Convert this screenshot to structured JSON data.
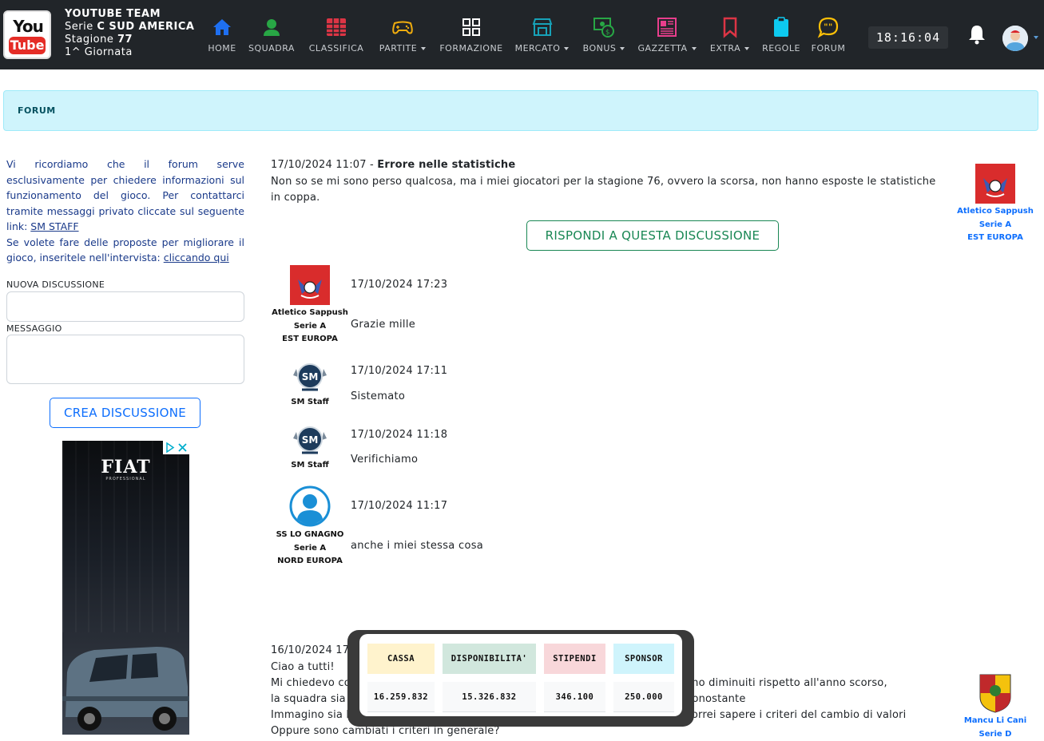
{
  "team": {
    "name": "YOUTUBE TEAM",
    "series_prefix": "Serie",
    "series": "C SUD AMERICA",
    "season_prefix": "Stagione",
    "season": "77",
    "round": "1^ Giornata",
    "logo_top": "You",
    "logo_bottom": "Tube"
  },
  "nav": [
    {
      "label": "HOME",
      "icon": "home-icon",
      "color": "#1e6ff0"
    },
    {
      "label": "SQUADRA",
      "icon": "user-icon",
      "color": "#28a745"
    },
    {
      "label": "CLASSIFICA",
      "icon": "table-icon",
      "color": "#dc3545"
    },
    {
      "label": "PARTITE",
      "icon": "gamepad-icon",
      "color": "#f0ad0e",
      "dropdown": true
    },
    {
      "label": "FORMAZIONE",
      "icon": "grid-icon",
      "color": "#ffffff"
    },
    {
      "label": "MERCATO",
      "icon": "shop-icon",
      "color": "#17a2b8",
      "dropdown": true
    },
    {
      "label": "BONUS",
      "icon": "cash-icon",
      "color": "#28a745",
      "dropdown": true
    },
    {
      "label": "GAZZETTA",
      "icon": "newspaper-icon",
      "color": "#e83e8c",
      "dropdown": true
    },
    {
      "label": "EXTRA",
      "icon": "bookmark-icon",
      "color": "#dc3545",
      "dropdown": true
    },
    {
      "label": "REGOLE",
      "icon": "clipboard-icon",
      "color": "#0dcaf0"
    },
    {
      "label": "FORUM",
      "icon": "chat-icon",
      "color": "#ffc107"
    }
  ],
  "clock": "18:16:04",
  "banner": "FORUM",
  "sidebar": {
    "notice_part1": "Vi ricordiamo che il forum serve esclusivamente per chiedere informazioni sul funzionamento del gioco. Per contattarci tramite messaggi privato cliccate sul seguente link: ",
    "staff_link": "SM STAFF",
    "notice_part2": "Se volete fare delle proposte per migliorare il gioco, inseritele nell'intervista: ",
    "interview_link": "cliccando qui",
    "new_discussion_label": "NUOVA DISCUSSIONE",
    "message_label": "MESSAGGIO",
    "create_button": "CREA DISCUSSIONE",
    "ad_brand": "FIAT",
    "ad_sub": "PROFESSIONAL"
  },
  "thread1": {
    "date": "17/10/2024 11:07 -",
    "title": "Errore nelle statistiche",
    "body": "Non so se mi sono perso qualcosa, ma i miei giocatori per la stagione 76, ovvero la scorsa, non hanno esposte le statistiche in coppa.",
    "author": {
      "name": "Atletico Sappush",
      "league": "Serie A",
      "group": "EST EUROPA"
    },
    "reply_button": "RISPONDI A QUESTA DISCUSSIONE",
    "replies": [
      {
        "date": "17/10/2024 17:23",
        "text": "Grazie mille",
        "author": {
          "name": "Atletico Sappush",
          "league": "Serie A",
          "group": "EST EUROPA"
        }
      },
      {
        "date": "17/10/2024 17:11",
        "text": "Sistemato",
        "author": {
          "name": "SM Staff"
        }
      },
      {
        "date": "17/10/2024 11:18",
        "text": "Verifichiamo",
        "author": {
          "name": "SM Staff"
        }
      },
      {
        "date": "17/10/2024 11:17",
        "text": "anche i miei stessa cosa",
        "author": {
          "name": "SS LO GNAGNO",
          "league": "Serie A",
          "group": "NORD EUROPA"
        }
      }
    ]
  },
  "thread2": {
    "date": "16/10/2024 17:2",
    "line1": "Ciao a tutti!",
    "line2a": "Mi chiedevo com",
    "line2b": "ano diminuiti rispetto all'anno scorso, nonostante",
    "line3": "la squadra sia la",
    "line4a": "Immagino sia leg",
    "line4b": "vorrei sapere i criteri del cambio di valori",
    "line5": "Oppure sono cambiati i criteri in generale?",
    "author": {
      "name": "Mancu Li Cani",
      "league": "Serie D"
    }
  },
  "finance": {
    "headers": [
      "CASSA",
      "DISPONIBILITA'",
      "STIPENDI",
      "SPONSOR"
    ],
    "values": [
      "16.259.832",
      "15.326.832",
      "346.100",
      "250.000"
    ],
    "header_colors": [
      "#fff3cd",
      "#d1e7dd",
      "#f8d7da",
      "#cff4fc"
    ]
  }
}
